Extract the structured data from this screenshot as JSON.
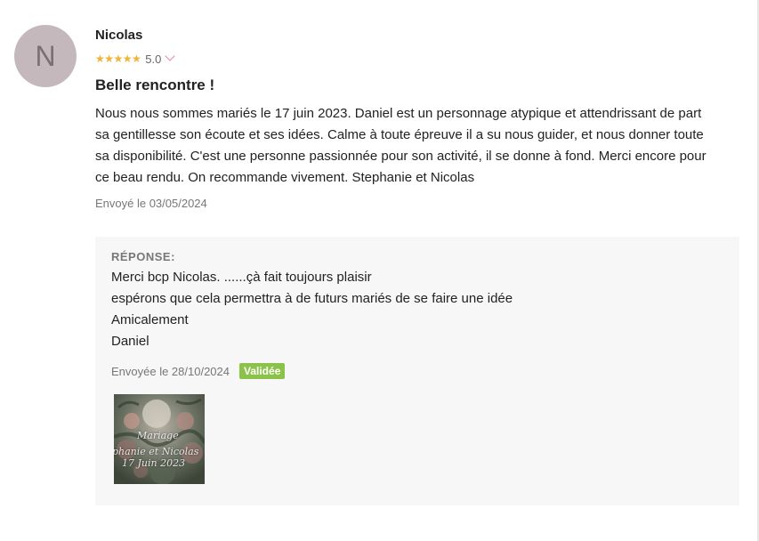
{
  "review": {
    "avatar_letter": "N",
    "author": "Nicolas",
    "rating": {
      "value": 5.0,
      "display": "5.0",
      "stars_glyph": "★★★★★",
      "star_color": "#f0b633"
    },
    "title": "Belle rencontre !",
    "body_lines": [
      "Nous nous sommes mariés le 17 juin 2023. Daniel est un personnage atypique et attendrissant de part",
      "sa gentillesse son écoute et ses idées. Calme à toute épreuve il a su nous guider, et nous donner toute",
      "sa disponibilité. C'est une personne passionnée pour son activité, il se donne à fond. Merci encore pour",
      "ce beau rendu. On recommande vivement. Stephanie et Nicolas"
    ],
    "sent_date": "Envoyé le 03/05/2024"
  },
  "response": {
    "label": "RÉPONSE:",
    "lines": [
      "Merci bcp Nicolas. ......çà fait toujours plaisir",
      "espérons que cela permettra à de futurs mariés de se faire une idée",
      "Amicalement",
      "Daniel"
    ],
    "sent_date": "Envoyée le 28/10/2024",
    "status_badge": "Validée",
    "badge_color": "#8bc34a",
    "photo_caption": [
      "Mariage",
      "phanie et Nicolas",
      "17 Juin 2023"
    ]
  }
}
